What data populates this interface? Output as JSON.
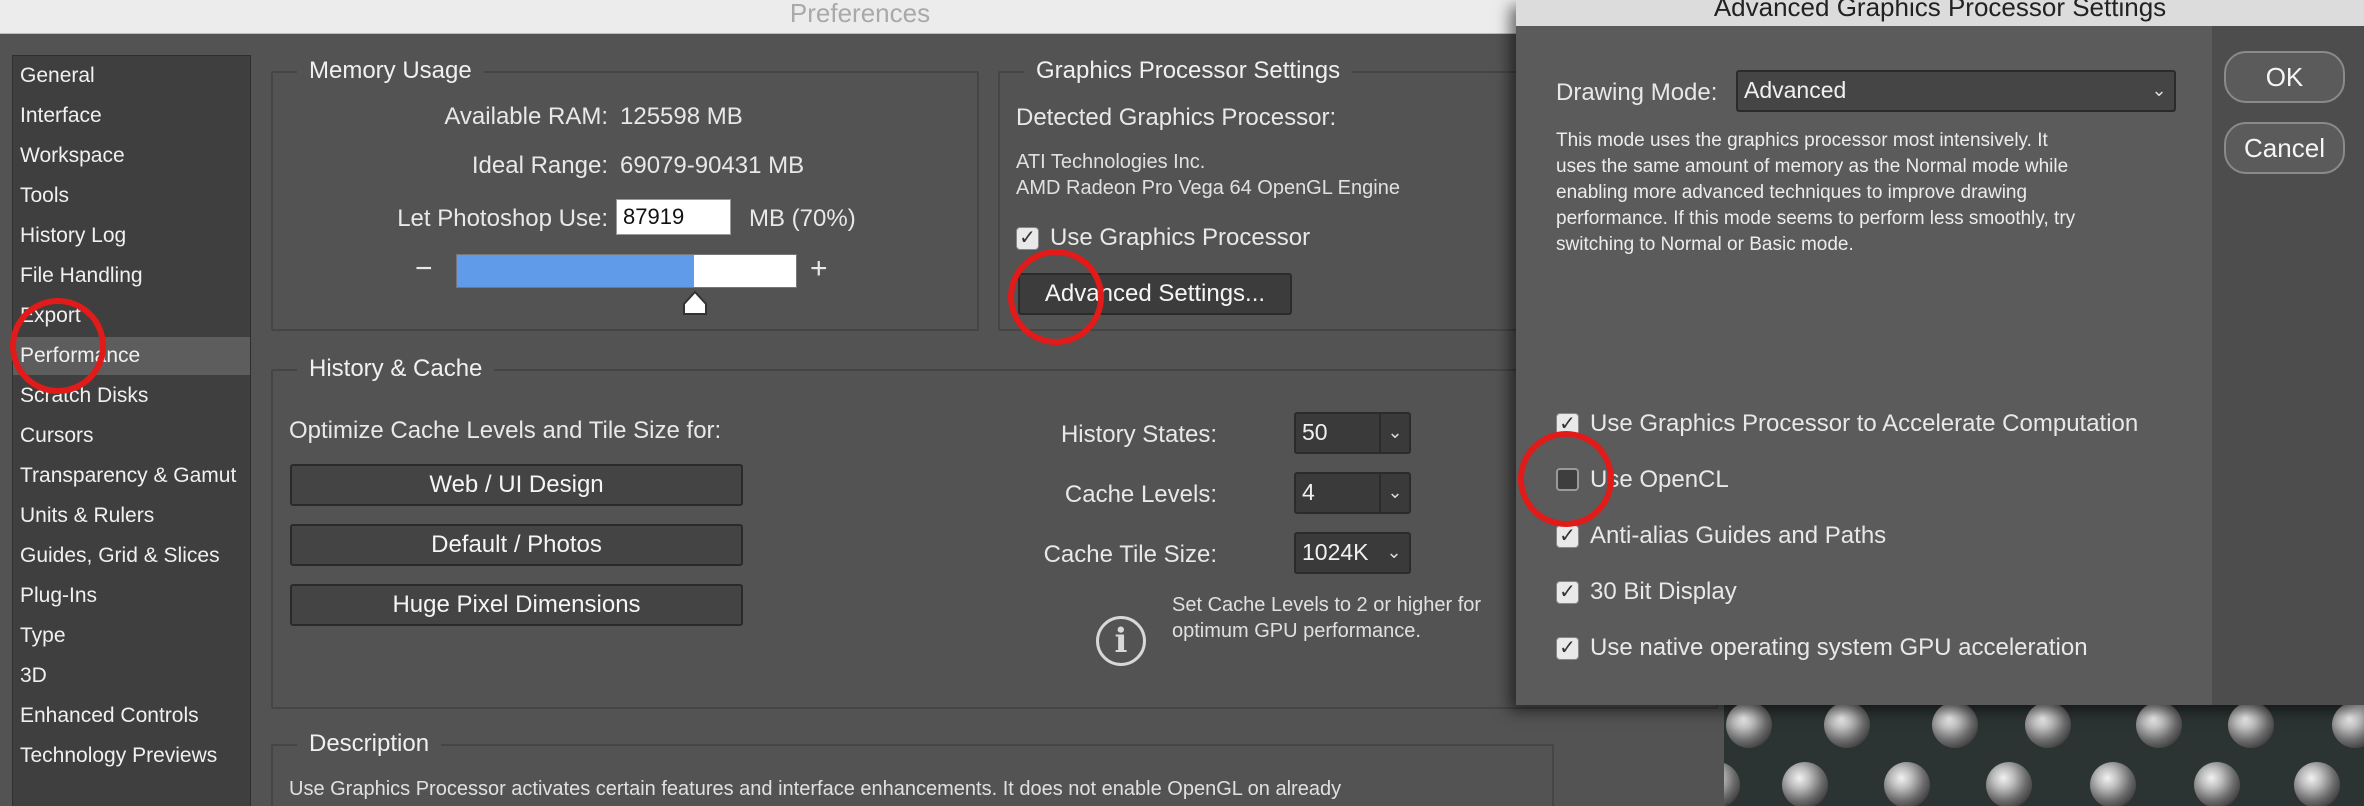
{
  "preferences": {
    "title": "Preferences",
    "sidebar": {
      "items": [
        {
          "label": "General"
        },
        {
          "label": "Interface"
        },
        {
          "label": "Workspace"
        },
        {
          "label": "Tools"
        },
        {
          "label": "History Log"
        },
        {
          "label": "File Handling"
        },
        {
          "label": "Export"
        },
        {
          "label": "Performance",
          "selected": true
        },
        {
          "label": "Scratch Disks"
        },
        {
          "label": "Cursors"
        },
        {
          "label": "Transparency & Gamut"
        },
        {
          "label": "Units & Rulers"
        },
        {
          "label": "Guides, Grid & Slices"
        },
        {
          "label": "Plug-Ins"
        },
        {
          "label": "Type"
        },
        {
          "label": "3D"
        },
        {
          "label": "Enhanced Controls"
        },
        {
          "label": "Technology Previews"
        }
      ]
    },
    "memory": {
      "title": "Memory Usage",
      "available_label": "Available RAM:",
      "available_value": "125598 MB",
      "ideal_label": "Ideal Range:",
      "ideal_value": "69079-90431 MB",
      "let_use_label": "Let Photoshop Use:",
      "let_use_value": "87919",
      "let_use_suffix": "MB (70%)",
      "minus": "−",
      "plus": "+",
      "slider_fraction": 0.7
    },
    "gpu": {
      "title": "Graphics Processor Settings",
      "detected_label": "Detected Graphics Processor:",
      "vendor": "ATI Technologies Inc.",
      "renderer": "AMD Radeon Pro Vega 64 OpenGL Engine",
      "use_gpu_label": "Use Graphics Processor",
      "use_gpu_checked": true,
      "advanced_button": "Advanced Settings..."
    },
    "history_cache": {
      "title": "History & Cache",
      "optimize_label": "Optimize Cache Levels and Tile Size for:",
      "buttons": [
        "Web / UI Design",
        "Default / Photos",
        "Huge Pixel Dimensions"
      ],
      "history_states_label": "History States:",
      "history_states_value": "50",
      "cache_levels_label": "Cache Levels:",
      "cache_levels_value": "4",
      "tile_size_label": "Cache Tile Size:",
      "tile_size_value": "1024K",
      "info_line1": "Set Cache Levels to 2 or higher for",
      "info_line2": "optimum GPU performance."
    },
    "description": {
      "title": "Description",
      "text": "Use Graphics Processor activates certain features and interface enhancements. It does not enable OpenGL on already"
    }
  },
  "advanced_dialog": {
    "title": "Advanced Graphics Processor Settings",
    "drawing_mode_label": "Drawing Mode:",
    "drawing_mode_value": "Advanced",
    "description": "This mode uses the graphics processor most intensively.  It\nuses the same amount of memory as the Normal mode while\nenabling more advanced techniques to improve drawing\nperformance.  If this mode seems to perform less smoothly, try\nswitching to Normal or Basic mode.",
    "options": [
      {
        "label": "Use Graphics Processor to Accelerate Computation",
        "checked": true
      },
      {
        "label": "Use OpenCL",
        "checked": false
      },
      {
        "label": "Anti-alias Guides and Paths",
        "checked": true
      },
      {
        "label": "30 Bit Display",
        "checked": true
      },
      {
        "label": "Use native operating system GPU acceleration",
        "checked": true
      }
    ],
    "ok_label": "OK",
    "cancel_label": "Cancel"
  },
  "colors": {
    "highlight_ring": "#e11a1a",
    "slider_fill": "#5f9be9"
  }
}
